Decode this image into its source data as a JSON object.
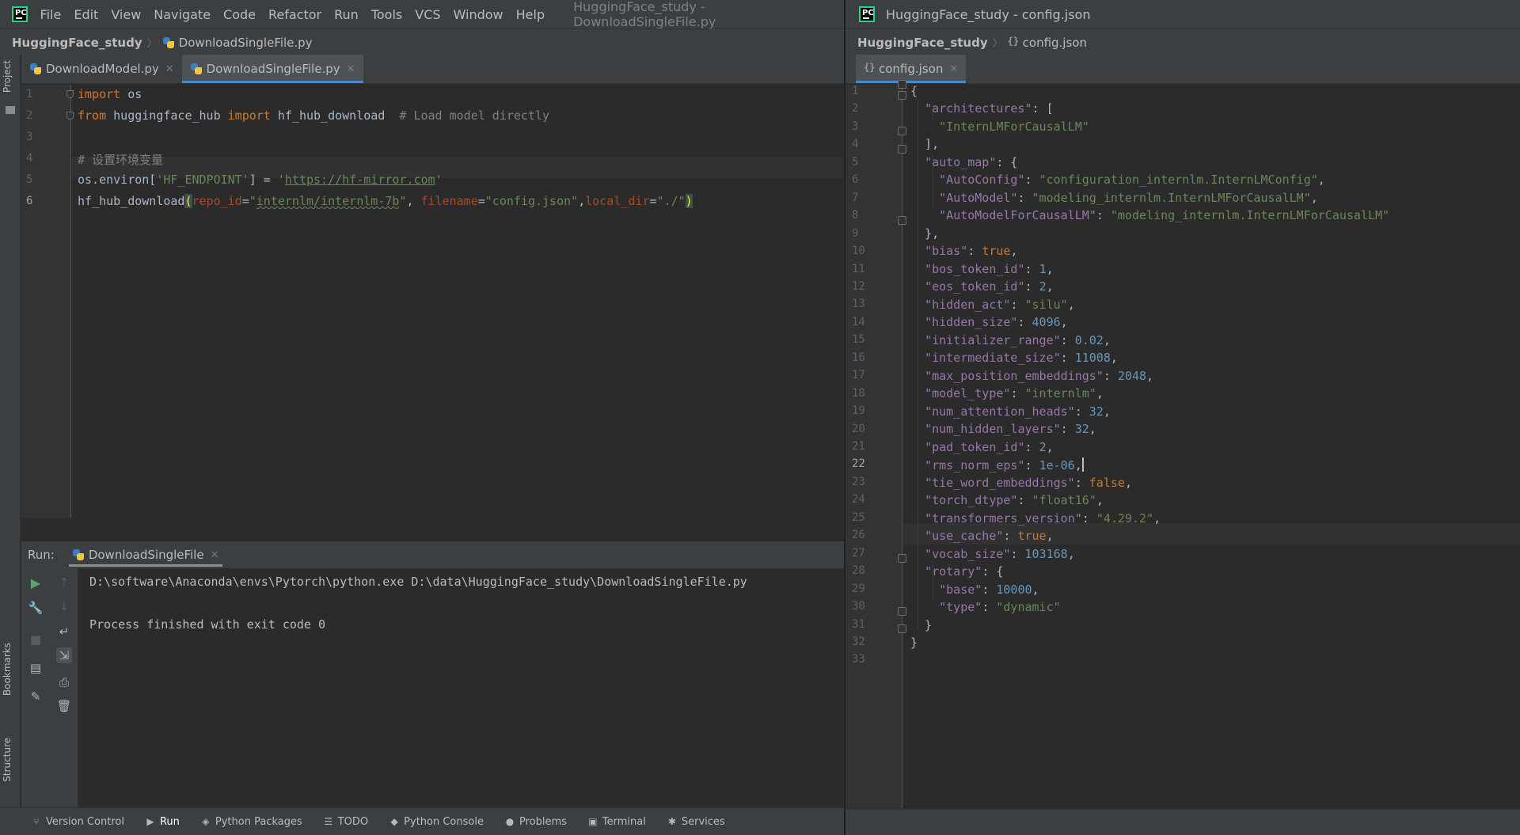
{
  "left_window": {
    "menu": [
      "File",
      "Edit",
      "View",
      "Navigate",
      "Code",
      "Refactor",
      "Run",
      "Tools",
      "VCS",
      "Window",
      "Help"
    ],
    "window_title": "HuggingFace_study - DownloadSingleFile.py",
    "breadcrumb": {
      "project": "HuggingFace_study",
      "file": "DownloadSingleFile.py"
    },
    "tabs": [
      {
        "label": "DownloadModel.py",
        "active": false
      },
      {
        "label": "DownloadSingleFile.py",
        "active": true
      }
    ],
    "side_labels": {
      "project": "Project",
      "bookmarks": "Bookmarks",
      "structure": "Structure"
    },
    "code": {
      "line_numbers": [
        "1",
        "2",
        "3",
        "4",
        "5",
        "6"
      ],
      "current_line": "6",
      "l1_kw": "import",
      "l1_rest": " os",
      "l2_kw1": "from",
      "l2_mod": " huggingface_hub ",
      "l2_kw2": "import",
      "l2_rest": " hf_hub_download  ",
      "l2_comment": "# Load model directly",
      "l4_comment": "# 设置环境变量",
      "l5_a": "os.environ[",
      "l5_key": "'HF_ENDPOINT'",
      "l5_b": "] = ",
      "l5_q1": "'",
      "l5_url": "https://hf-mirror.com",
      "l5_q2": "'",
      "l6_fn": "hf_hub_download",
      "l6_open": "(",
      "l6_p1": "repo_id",
      "l6_eq1": "=",
      "l6_q1": "\"",
      "l6_v1": "internlm/internlm-7b",
      "l6_q1b": "\"",
      "l6_c1": ", ",
      "l6_p2": "filename",
      "l6_eq2": "=",
      "l6_v2": "\"config.json\"",
      "l6_c2": ",",
      "l6_p3": "local_dir",
      "l6_eq3": "=",
      "l6_v3": "\"./\"",
      "l6_close": ")"
    },
    "run_panel": {
      "label": "Run:",
      "tab": "DownloadSingleFile",
      "output": [
        "D:\\software\\Anaconda\\envs\\Pytorch\\python.exe D:\\data\\HuggingFace_study\\DownloadSingleFile.py",
        "Process finished with exit code 0"
      ]
    },
    "status_bar": [
      {
        "label": "Version Control",
        "icon": "branch-icon"
      },
      {
        "label": "Run",
        "icon": "play-icon",
        "active": true
      },
      {
        "label": "Python Packages",
        "icon": "layers-icon"
      },
      {
        "label": "TODO",
        "icon": "list-icon"
      },
      {
        "label": "Python Console",
        "icon": "python-icon"
      },
      {
        "label": "Problems",
        "icon": "info-icon"
      },
      {
        "label": "Terminal",
        "icon": "terminal-icon"
      },
      {
        "label": "Services",
        "icon": "services-icon"
      }
    ]
  },
  "right_window": {
    "window_title": "HuggingFace_study - config.json",
    "breadcrumb": {
      "project": "HuggingFace_study",
      "file": "config.json"
    },
    "tab": "config.json",
    "current_line": "22",
    "line_numbers": [
      "1",
      "2",
      "3",
      "4",
      "5",
      "6",
      "7",
      "8",
      "9",
      "10",
      "11",
      "12",
      "13",
      "14",
      "15",
      "16",
      "17",
      "18",
      "19",
      "20",
      "21",
      "22",
      "23",
      "24",
      "25",
      "26",
      "27",
      "28",
      "29",
      "30",
      "31",
      "32",
      "33"
    ],
    "json": {
      "architectures_key": "\"architectures\"",
      "architectures_val": "\"InternLMForCausalLM\"",
      "auto_map_key": "\"auto_map\"",
      "auto_config_key": "\"AutoConfig\"",
      "auto_config_val": "\"configuration_internlm.InternLMConfig\"",
      "auto_model_key": "\"AutoModel\"",
      "auto_model_val": "\"modeling_internlm.InternLMForCausalLM\"",
      "auto_causal_key": "\"AutoModelForCausalLM\"",
      "auto_causal_val": "\"modeling_internlm.InternLMForCausalLM\"",
      "bias_key": "\"bias\"",
      "bias_val": "true",
      "bos_key": "\"bos_token_id\"",
      "bos_val": "1",
      "eos_key": "\"eos_token_id\"",
      "eos_val": "2",
      "act_key": "\"hidden_act\"",
      "act_val": "\"silu\"",
      "hsize_key": "\"hidden_size\"",
      "hsize_val": "4096",
      "init_key": "\"initializer_range\"",
      "init_val": "0.02",
      "inter_key": "\"intermediate_size\"",
      "inter_val": "11008",
      "maxpos_key": "\"max_position_embeddings\"",
      "maxpos_val": "2048",
      "mtype_key": "\"model_type\"",
      "mtype_val": "\"internlm\"",
      "heads_key": "\"num_attention_heads\"",
      "heads_val": "32",
      "layers_key": "\"num_hidden_layers\"",
      "layers_val": "32",
      "pad_key": "\"pad_token_id\"",
      "pad_val": "2",
      "rms_key": "\"rms_norm_eps\"",
      "rms_val": "1e-06",
      "tie_key": "\"tie_word_embeddings\"",
      "tie_val": "false",
      "dtype_key": "\"torch_dtype\"",
      "dtype_val": "\"float16\"",
      "tver_key": "\"transformers_version\"",
      "tver_val": "\"4.29.2\"",
      "cache_key": "\"use_cache\"",
      "cache_val": "true",
      "vocab_key": "\"vocab_size\"",
      "vocab_val": "103168",
      "rotary_key": "\"rotary\"",
      "base_key": "\"base\"",
      "base_val": "10000",
      "type_key": "\"type\"",
      "type_val": "\"dynamic\""
    }
  }
}
